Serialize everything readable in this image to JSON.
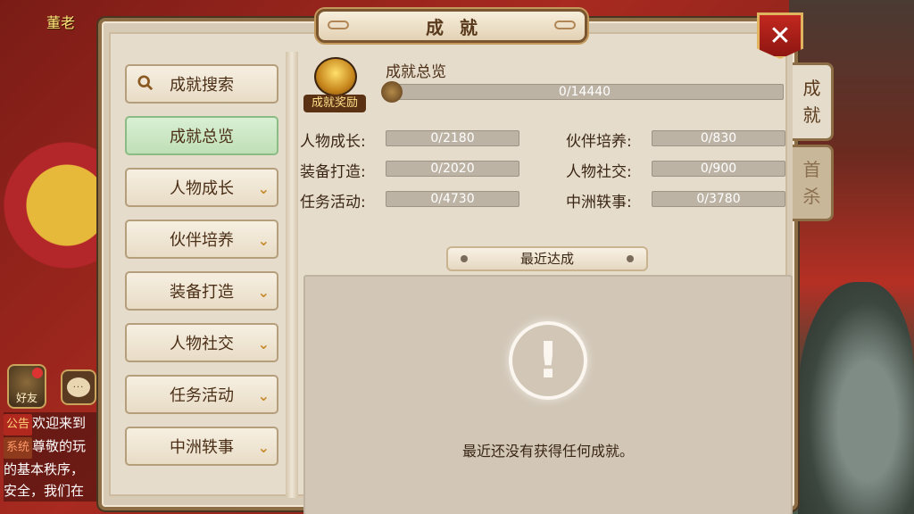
{
  "scene": {
    "npc_name": "董老",
    "friend_label": "好友",
    "chat": [
      {
        "tag": "公告",
        "text": "欢迎来到"
      },
      {
        "tag": "系统",
        "text": "尊敬的玩"
      },
      {
        "tag": "",
        "text": "的基本秩序，"
      },
      {
        "tag": "",
        "text": "安全，我们在"
      }
    ]
  },
  "dialog": {
    "title": "成就",
    "close_label": "✕"
  },
  "nav": {
    "items": [
      {
        "label": "成就搜索",
        "has_chevron": false,
        "active": false
      },
      {
        "label": "成就总览",
        "has_chevron": false,
        "active": true
      },
      {
        "label": "人物成长",
        "has_chevron": true,
        "active": false
      },
      {
        "label": "伙伴培养",
        "has_chevron": true,
        "active": false
      },
      {
        "label": "装备打造",
        "has_chevron": true,
        "active": false
      },
      {
        "label": "人物社交",
        "has_chevron": true,
        "active": false
      },
      {
        "label": "任务活动",
        "has_chevron": true,
        "active": false
      },
      {
        "label": "中洲轶事",
        "has_chevron": true,
        "active": false
      }
    ]
  },
  "overview": {
    "reward_label": "成就奖励",
    "title": "成就总览",
    "total_progress": "0/14440",
    "stats": [
      {
        "label": "人物成长:",
        "value": "0/2180"
      },
      {
        "label": "伙伴培养:",
        "value": "0/830"
      },
      {
        "label": "装备打造:",
        "value": "0/2020"
      },
      {
        "label": "人物社交:",
        "value": "0/900"
      },
      {
        "label": "任务活动:",
        "value": "0/4730"
      },
      {
        "label": "中洲轶事:",
        "value": "0/3780"
      }
    ]
  },
  "recent": {
    "banner": "最近达成",
    "empty_icon": "!",
    "empty_message": "最近还没有获得任何成就。"
  },
  "side_tabs": [
    {
      "label_top": "成",
      "label_bottom": "就",
      "active": true
    },
    {
      "label_top": "首",
      "label_bottom": "杀",
      "active": false
    }
  ],
  "colors": {
    "accent_red": "#c1281f",
    "active_nav": "#bfe0b6",
    "panel_bg": "#e6dccb",
    "bar_bg": "#bdb3a5"
  }
}
